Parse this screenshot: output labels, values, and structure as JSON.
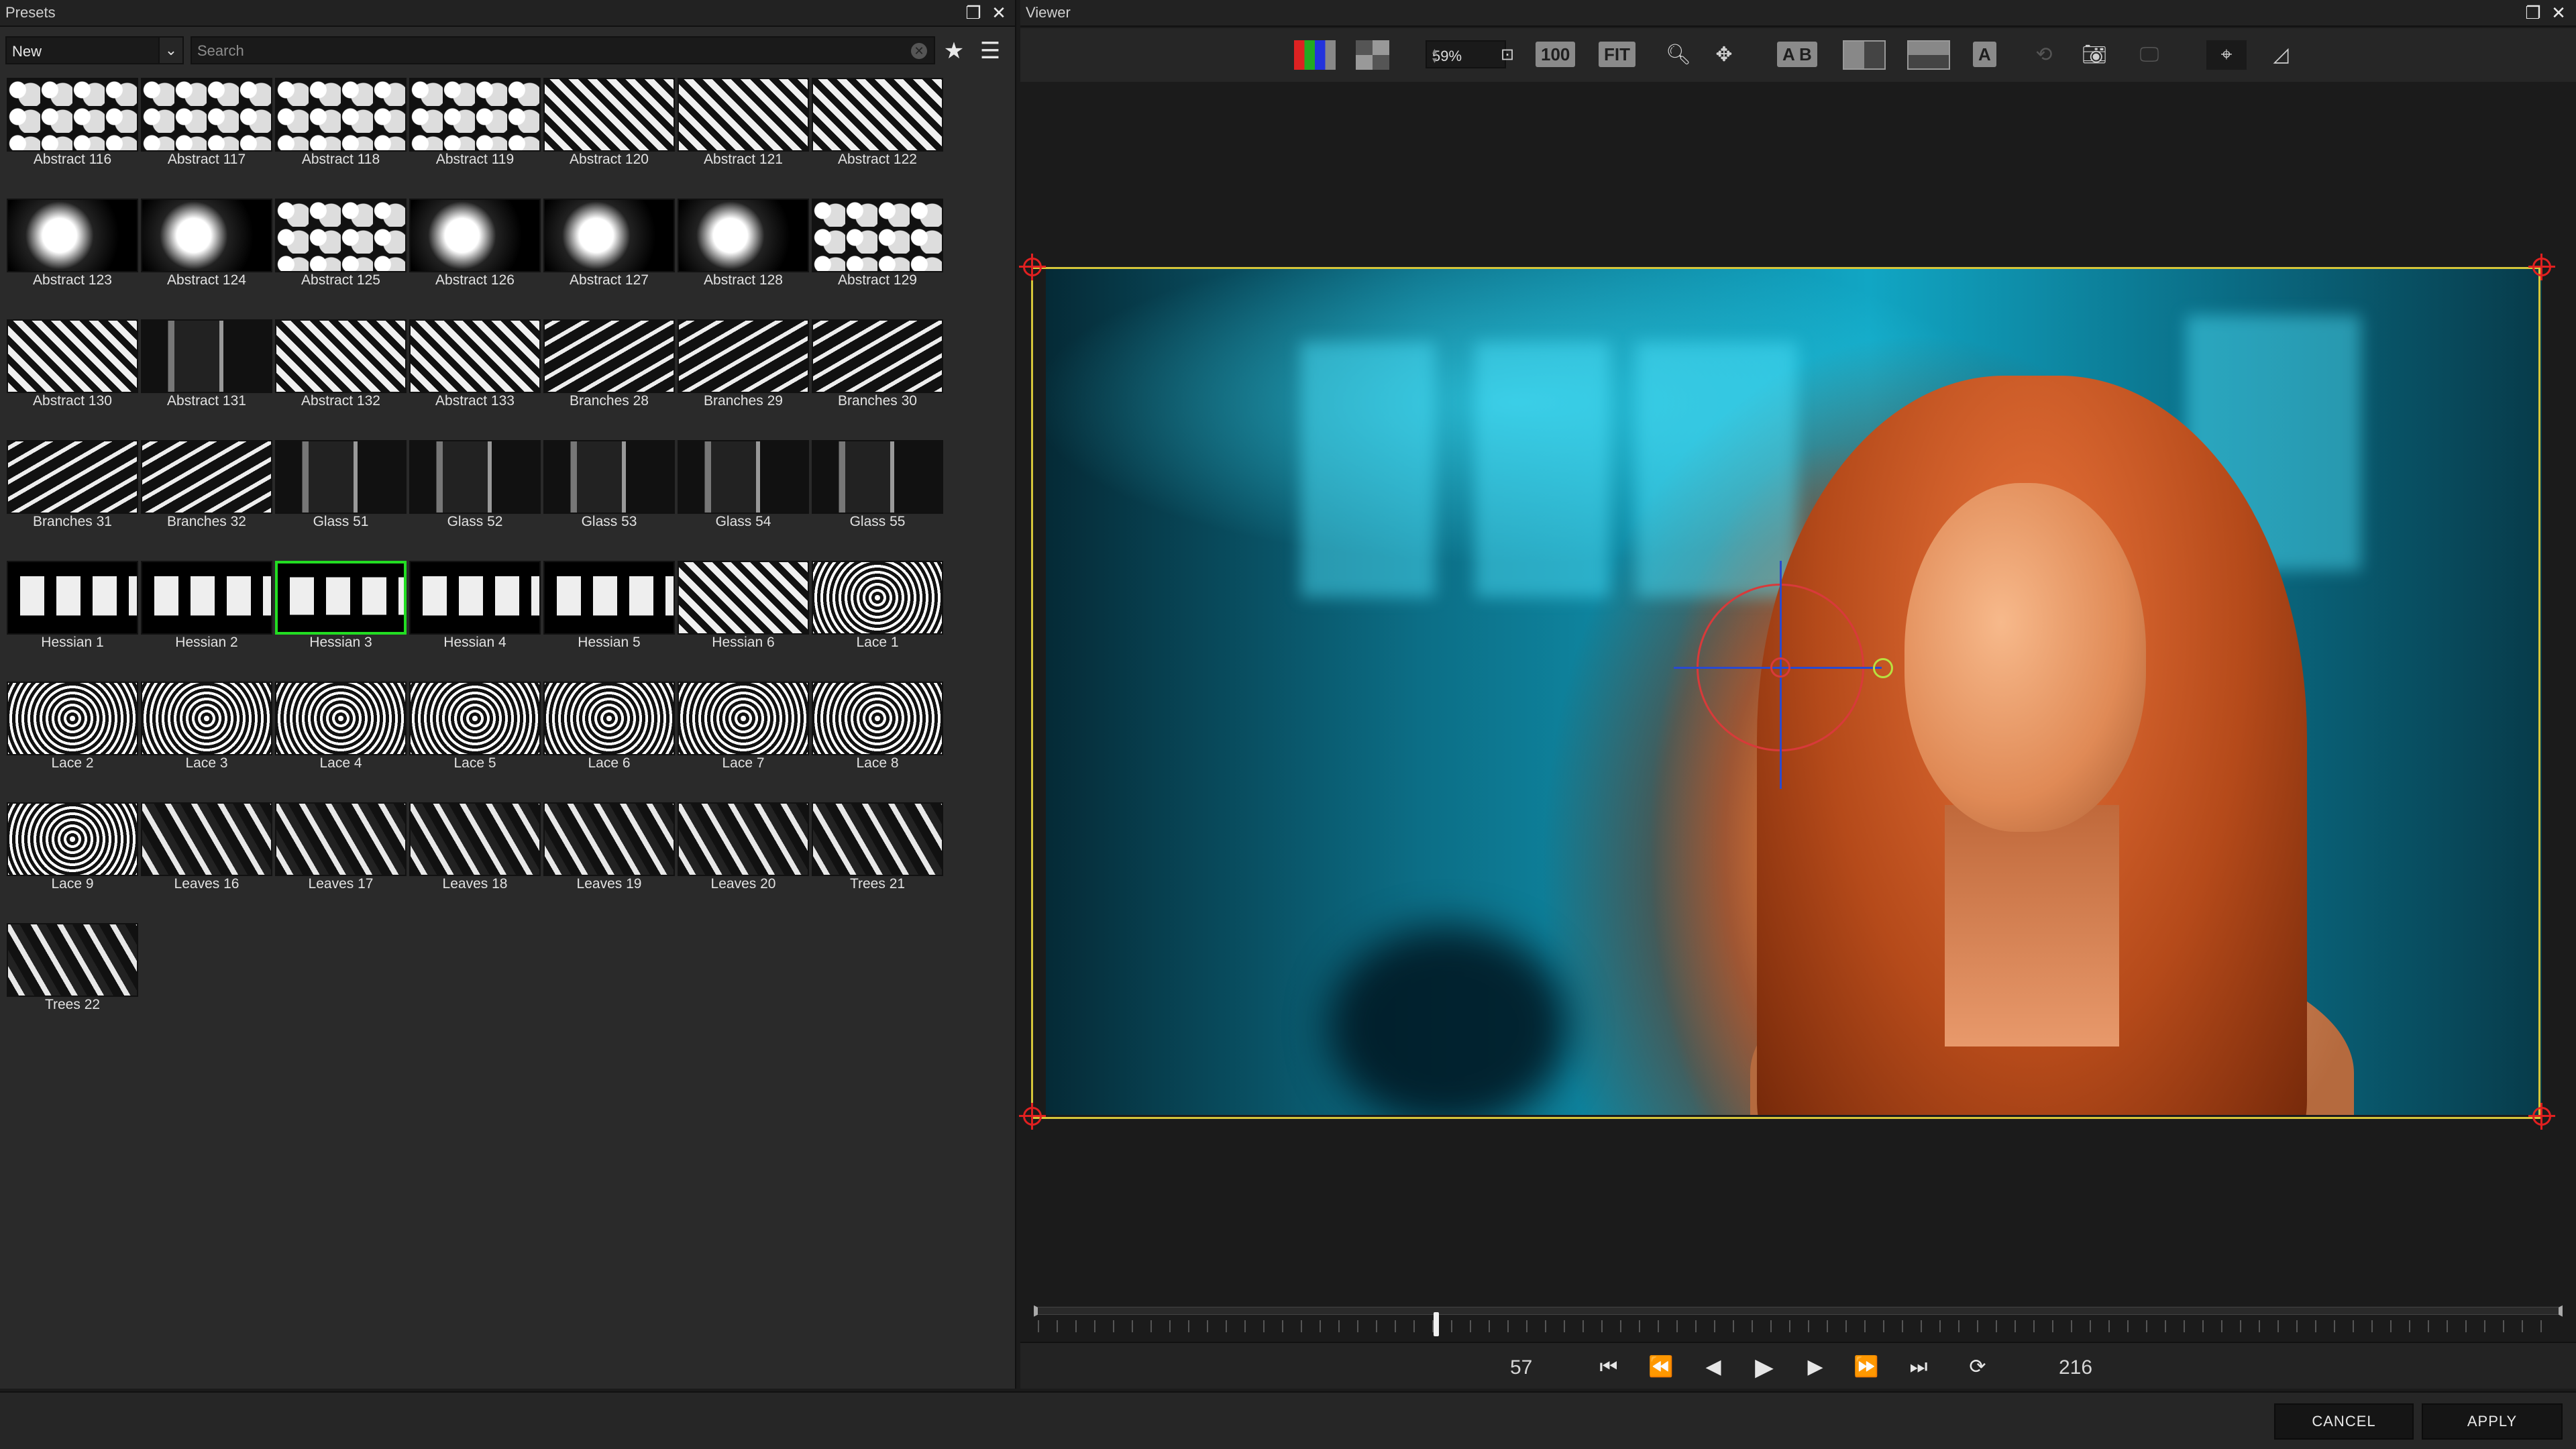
{
  "presets_panel": {
    "title": "Presets",
    "filter_value": "New",
    "search_placeholder": "Search",
    "items": [
      {
        "label": "Abstract 116",
        "pattern": "abstract"
      },
      {
        "label": "Abstract 117",
        "pattern": "abstract"
      },
      {
        "label": "Abstract 118",
        "pattern": "abstract"
      },
      {
        "label": "Abstract 119",
        "pattern": "abstract"
      },
      {
        "label": "Abstract 120",
        "pattern": "stripe"
      },
      {
        "label": "Abstract 121",
        "pattern": "stripe"
      },
      {
        "label": "Abstract 122",
        "pattern": "stripe"
      },
      {
        "label": "Abstract 123",
        "pattern": "splash"
      },
      {
        "label": "Abstract 124",
        "pattern": "splash"
      },
      {
        "label": "Abstract 125",
        "pattern": "abstract"
      },
      {
        "label": "Abstract 126",
        "pattern": "splash"
      },
      {
        "label": "Abstract 127",
        "pattern": "splash"
      },
      {
        "label": "Abstract 128",
        "pattern": "splash"
      },
      {
        "label": "Abstract 129",
        "pattern": "abstract"
      },
      {
        "label": "Abstract 130",
        "pattern": "stripe"
      },
      {
        "label": "Abstract 131",
        "pattern": "glass"
      },
      {
        "label": "Abstract 132",
        "pattern": "stripe"
      },
      {
        "label": "Abstract 133",
        "pattern": "stripe"
      },
      {
        "label": "Branches 28",
        "pattern": "branch"
      },
      {
        "label": "Branches 29",
        "pattern": "branch"
      },
      {
        "label": "Branches 30",
        "pattern": "branch"
      },
      {
        "label": "Branches 31",
        "pattern": "branch"
      },
      {
        "label": "Branches 32",
        "pattern": "branch"
      },
      {
        "label": "Glass 51",
        "pattern": "glass"
      },
      {
        "label": "Glass 52",
        "pattern": "glass"
      },
      {
        "label": "Glass 53",
        "pattern": "glass"
      },
      {
        "label": "Glass 54",
        "pattern": "glass"
      },
      {
        "label": "Glass 55",
        "pattern": "glass"
      },
      {
        "label": "Hessian 1",
        "pattern": "hessian"
      },
      {
        "label": "Hessian 2",
        "pattern": "hessian"
      },
      {
        "label": "Hessian 3",
        "pattern": "hessian",
        "selected": true
      },
      {
        "label": "Hessian 4",
        "pattern": "hessian"
      },
      {
        "label": "Hessian 5",
        "pattern": "hessian"
      },
      {
        "label": "Hessian 6",
        "pattern": "stripe"
      },
      {
        "label": "Lace 1",
        "pattern": "lace"
      },
      {
        "label": "Lace 2",
        "pattern": "lace"
      },
      {
        "label": "Lace 3",
        "pattern": "lace"
      },
      {
        "label": "Lace 4",
        "pattern": "lace"
      },
      {
        "label": "Lace 5",
        "pattern": "lace"
      },
      {
        "label": "Lace 6",
        "pattern": "lace"
      },
      {
        "label": "Lace 7",
        "pattern": "lace"
      },
      {
        "label": "Lace 8",
        "pattern": "lace"
      },
      {
        "label": "Lace 9",
        "pattern": "lace"
      },
      {
        "label": "Leaves 16",
        "pattern": "leaves"
      },
      {
        "label": "Leaves 17",
        "pattern": "leaves"
      },
      {
        "label": "Leaves 18",
        "pattern": "leaves"
      },
      {
        "label": "Leaves 19",
        "pattern": "leaves"
      },
      {
        "label": "Leaves 20",
        "pattern": "leaves"
      },
      {
        "label": "Trees 21",
        "pattern": "leaves"
      },
      {
        "label": "Trees 22",
        "pattern": "leaves"
      }
    ]
  },
  "viewer_panel": {
    "title": "Viewer",
    "zoom_value": "59%",
    "btn_100": "100",
    "btn_fit": "FIT",
    "btn_ab": "A B",
    "btn_a": "A"
  },
  "transport": {
    "current_frame": "57",
    "end_frame": "216"
  },
  "footer": {
    "cancel_label": "CANCEL",
    "apply_label": "APPLY"
  },
  "colors": {
    "selection": "#22dd22",
    "frame_outline": "#d6c63a",
    "crosshair_red": "#d83a3a",
    "crosshair_blue": "#2a4ad0"
  }
}
